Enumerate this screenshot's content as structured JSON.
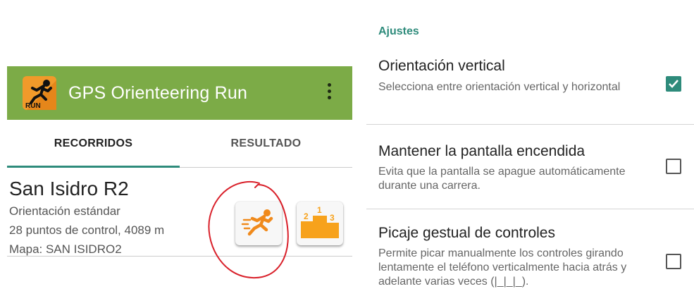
{
  "app": {
    "title": "GPS Orienteering Run",
    "logo_text": "RUN",
    "accent_color": "#7cab47",
    "icons": {
      "logo": "runner-logo-icon",
      "menu": "more-vert-icon"
    }
  },
  "tabs": [
    {
      "label": "RECORRIDOS",
      "selected": true
    },
    {
      "label": "RESULTADO",
      "selected": false
    }
  ],
  "course": {
    "title": "San Isidro R2",
    "type": "Orientación estándar",
    "stats": "28 puntos de control, 4089 m",
    "map": "Mapa: SAN ISIDRO2",
    "buttons": {
      "run_icon": "runner-icon",
      "results_icon": "podium-icon",
      "podium_labels": [
        "2",
        "1",
        "3"
      ]
    }
  },
  "settings": {
    "header": "Ajustes",
    "header_color": "#2e8b7b",
    "items": [
      {
        "title": "Orientación vertical",
        "summary": "Selecciona entre orientación vertical y horizontal",
        "checked": true
      },
      {
        "title": "Mantener la pantalla encendida",
        "summary": "Evita que la pantalla se apague automáticamente durante una carrera.",
        "checked": false
      },
      {
        "title": "Picaje gestual de controles",
        "summary": "Permite picar manualmente los controles girando lentamente el teléfono verticalmente hacia atrás y adelante varias veces (|_|_|_).",
        "checked": false
      }
    ]
  }
}
